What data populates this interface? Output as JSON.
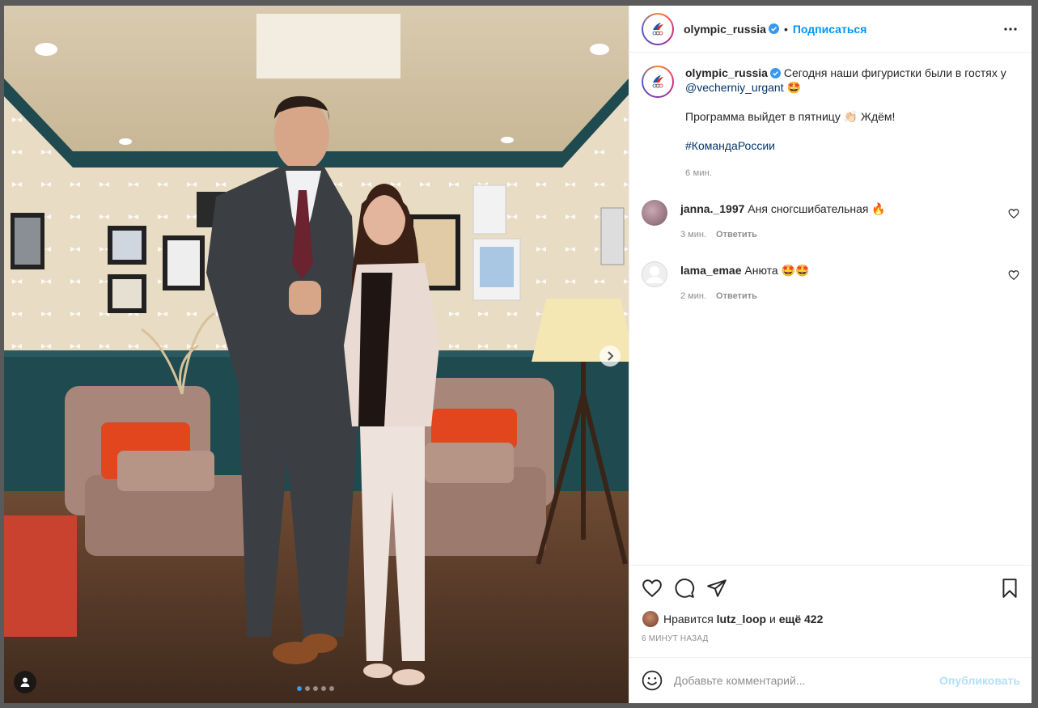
{
  "post": {
    "username": "olympic_russia",
    "follow_label": "Подписаться",
    "separator": "•",
    "carousel": {
      "total": 5,
      "active": 1
    }
  },
  "caption": {
    "username": "olympic_russia",
    "line1": "Сегодня наши фигуристки были в гостях у",
    "mention": "@vecherniy_urgant",
    "emoji1": "🤩",
    "line2": "Программа выйдет в пятницу",
    "emoji2": "👏🏻",
    "line2_end": "Ждём!",
    "hashtag": "#КомандаРоссии",
    "time": "6 мин."
  },
  "comments": [
    {
      "username": "janna._1997",
      "text": "Аня сногсшибательная",
      "emoji": "🔥",
      "time": "3 мин.",
      "reply": "Ответить"
    },
    {
      "username": "lama_emae",
      "text": "Анюта",
      "emoji": "🤩🤩",
      "time": "2 мин.",
      "reply": "Ответить"
    }
  ],
  "likes": {
    "prefix": "Нравится",
    "user": "lutz_loop",
    "middle": "и",
    "rest": "ещё 422"
  },
  "posted_ago": "6 минут назад",
  "compose": {
    "placeholder": "Добавьте комментарий...",
    "publish_label": "Опубликовать"
  },
  "colors": {
    "link": "#00376b",
    "follow": "#0095f6",
    "publish_disabled": "#b2dffc",
    "wall_teal": "#1f4a50"
  }
}
